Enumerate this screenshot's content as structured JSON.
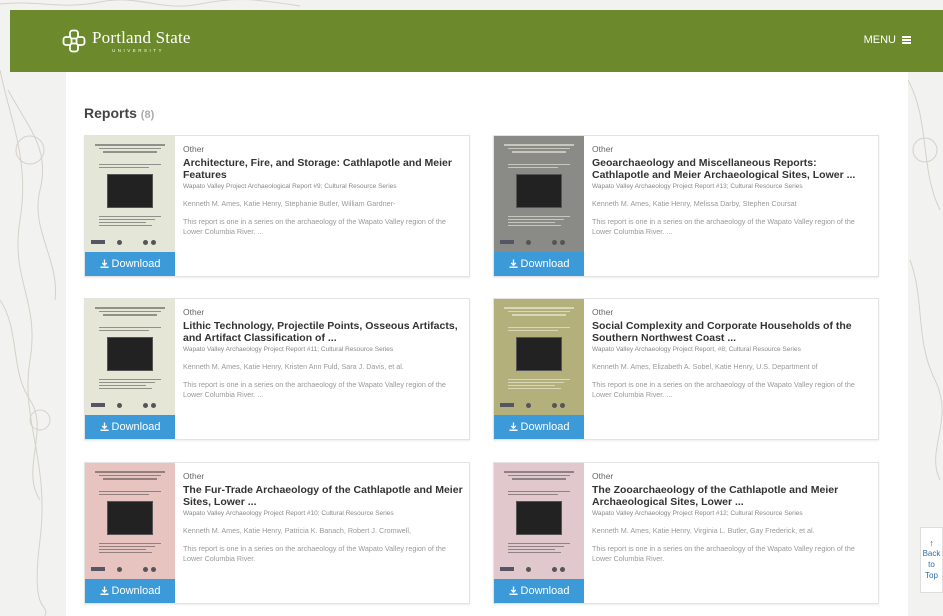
{
  "header": {
    "logo_text": "Portland State",
    "logo_sub": "UNIVERSITY",
    "menu_label": "MENU",
    "brand_color": "#6c8a2b"
  },
  "page": {
    "title": "Reports",
    "count": "(8)"
  },
  "download_label": "Download",
  "back_to_top": {
    "line1": "Back",
    "line2": "to",
    "line3": "Top"
  },
  "reports": [
    {
      "category": "Other",
      "title": "Architecture, Fire, and Storage: Cathlapotle and Meier Features",
      "series": "Wapato Valley Project Archaeological Report #9; Cultural Resource Series",
      "authors": "Kenneth M. Ames, Katie Henry, Stephanie Butler, William Gardner-",
      "description": "This report is one in a series on the archaeology of the Wapato Valley region of the Lower Columbia River. ...",
      "cover_color": "#e4e6d8"
    },
    {
      "category": "Other",
      "title": "Geoarchaeology and Miscellaneous Reports: Cathlapotle and Meier Archaeological Sites, Lower ...",
      "series": "Wapato Valley Archaeology Project Report #13; Cultural Resource Series",
      "authors": "Kenneth M. Ames, Katie Henry, Melissa Darby, Stephen Coursat",
      "description": "This report is one in a series on the archaeology of the Wapato Valley region of the Lower Columbia River. ...",
      "cover_color": "#8a8a86"
    },
    {
      "category": "Other",
      "title": "Lithic Technology, Projectile Points, Osseous Artifacts, and Artifact Classification of ...",
      "series": "Wapato Valley Archaeology Project Report #11; Cultural Resource Series",
      "authors": "Kenneth M. Ames, Katie Henry, Kristen Ann Fuld, Sara J. Davis, et al.",
      "description": "This report is one in a series on the archaeology of the Wapato Valley region of the Lower Columbia River. ...",
      "cover_color": "#e6e6d6"
    },
    {
      "category": "Other",
      "title": "Social Complexity and Corporate Households of the Southern Northwest Coast ...",
      "series": "Wapato Valley Archaeology Project Report, #8; Cultural Resource Series",
      "authors": "Kenneth M. Ames, Elizabeth A. Sobel, Katie Henry, U.S. Department of",
      "description": "This report is one in a series on the archaeology of the Wapato Valley region of the Lower Columbia River. ...",
      "cover_color": "#b3b07c"
    },
    {
      "category": "Other",
      "title": "The Fur-Trade Archaeology of the Cathlapotle and Meier Sites, Lower ...",
      "series": "Wapato Valley Archaeology Project Report #10; Cultural Resource Series",
      "authors": "Kenneth M. Ames, Katie Henry, Patricia K. Banach, Robert J. Cromwell,",
      "description": "This report is one in a series on the archaeology of the Wapato Valley region of the Lower Columbia River.",
      "cover_color": "#e8c4c0"
    },
    {
      "category": "Other",
      "title": "The Zooarchaeology of the Cathlapotle and Meier Archaeological Sites, Lower ...",
      "series": "Wapato Valley Archaeology Project Report #12; Cultural Resource Series",
      "authors": "Kenneth M. Ames, Katie Henry, Virginia L. Butler, Gay Frederick, et al.",
      "description": "This report is one in a series on the archaeology of the Wapato Valley region of the Lower Columbia River.",
      "cover_color": "#e0c8cc"
    }
  ]
}
